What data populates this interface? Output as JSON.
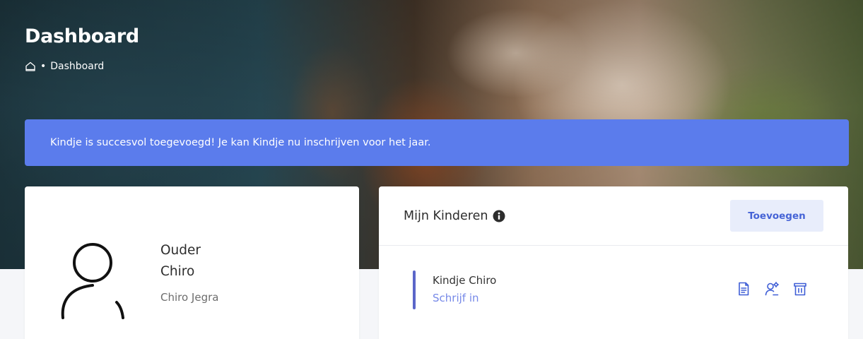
{
  "header": {
    "title": "Dashboard",
    "breadcrumb": {
      "home_icon": "home-icon",
      "separator": "•",
      "current": "Dashboard"
    }
  },
  "alert": {
    "message": "Kindje is succesvol toegevoegd! Je kan Kindje nu inschrijven voor het jaar.",
    "color": "#5b7cec"
  },
  "profile": {
    "avatar_icon": "user-icon",
    "name_first": "Ouder",
    "name_last": "Chiro",
    "group": "Chiro Jegra"
  },
  "kids": {
    "title": "Mijn Kinderen",
    "info_icon": "info-icon",
    "add_button": "Toevoegen",
    "items": [
      {
        "name": "Kindje Chiro",
        "action_link": "Schrijf in",
        "icons": [
          "document-icon",
          "user-settings-icon",
          "trash-icon"
        ]
      }
    ]
  },
  "colors": {
    "accent": "#5b7cec",
    "link": "#7689e8",
    "button_bg": "#e8edfb",
    "button_text": "#4563d6"
  }
}
